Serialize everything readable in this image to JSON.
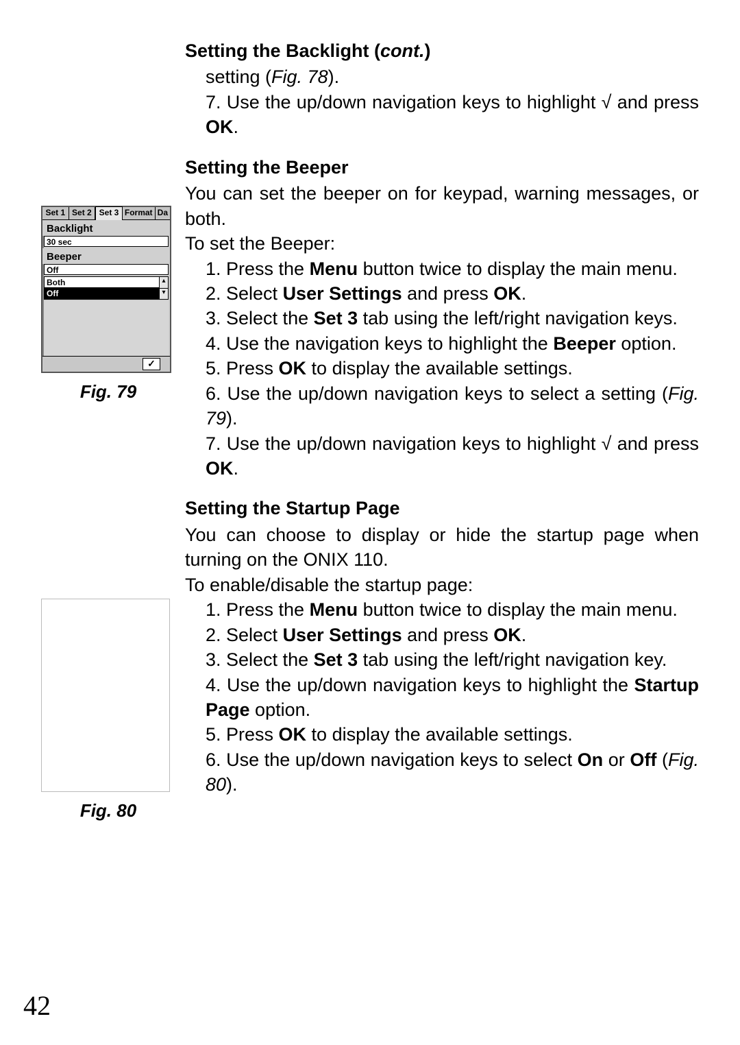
{
  "page_number": "42",
  "sec1": {
    "heading_plain": "Setting the Backlight (",
    "heading_ital": "cont.",
    "heading_close": ")",
    "line_a1": "setting (",
    "line_a2": "Fig. 78",
    "line_a3": ").",
    "step7_a": "7. Use the up/down navigation keys to highlight √ and press ",
    "step7_b": "OK",
    "step7_c": "."
  },
  "sec2": {
    "heading": "Setting the Beeper",
    "intro": "You can set the beeper on for keypad, warning messages, or both.",
    "to": "To set the Beeper:",
    "s1a": "1. Press the ",
    "s1b": "Menu",
    "s1c": " button twice to display the main menu.",
    "s2a": "2. Select ",
    "s2b": "User Settings",
    "s2c": " and press ",
    "s2d": "OK",
    "s2e": ".",
    "s3a": "3. Select the ",
    "s3b": "Set 3",
    "s3c": " tab using the left/right navigation keys.",
    "s4a": "4. Use the navigation keys to highlight the ",
    "s4b": "Beeper",
    "s4c": " option.",
    "s5a": "5. Press ",
    "s5b": "OK",
    "s5c": " to display the available settings.",
    "s6a": "6. Use the up/down navigation keys to select a setting (",
    "s6b": "Fig. 79",
    "s6c": ").",
    "s7a": "7. Use the up/down navigation keys to highlight √ and press ",
    "s7b": "OK",
    "s7c": "."
  },
  "sec3": {
    "heading": "Setting the Startup Page",
    "intro": "You can choose to display or hide the startup page when turning on the ONIX 110.",
    "to": "To enable/disable the startup page:",
    "s1a": "1. Press the ",
    "s1b": "Menu",
    "s1c": " button twice to display the main menu.",
    "s2a": "2. Select ",
    "s2b": "User Settings",
    "s2c": " and press ",
    "s2d": "OK",
    "s2e": ".",
    "s3a": "3. Select the ",
    "s3b": "Set 3",
    "s3c": " tab using the left/right navigation key.",
    "s4a": "4. Use the up/down navigation keys to highlight the ",
    "s4b": "Startup Page",
    "s4c": " option.",
    "s5a": "5. Press ",
    "s5b": "OK",
    "s5c": " to display the available settings.",
    "s6a": "6. Use the up/down navigation keys to select ",
    "s6b": "On",
    "s6c": " or ",
    "s6d": "Off",
    "s6e": " (",
    "s6f": "Fig. 80",
    "s6g": ")."
  },
  "fig79": {
    "caption": "Fig. 79",
    "tabs": {
      "t1": "Set 1",
      "t2": "Set 2",
      "t3": "Set 3",
      "t4": "Format",
      "t5": "Da"
    },
    "group_backlight": "Backlight",
    "backlight_value": "30 sec",
    "group_beeper": "Beeper",
    "beeper_value": "Off",
    "dropdown": {
      "opt1": "Both",
      "opt2": "Off"
    },
    "arrow_up": "▴",
    "arrow_dn": "▾",
    "check": "✓"
  },
  "fig80": {
    "caption": "Fig. 80"
  }
}
